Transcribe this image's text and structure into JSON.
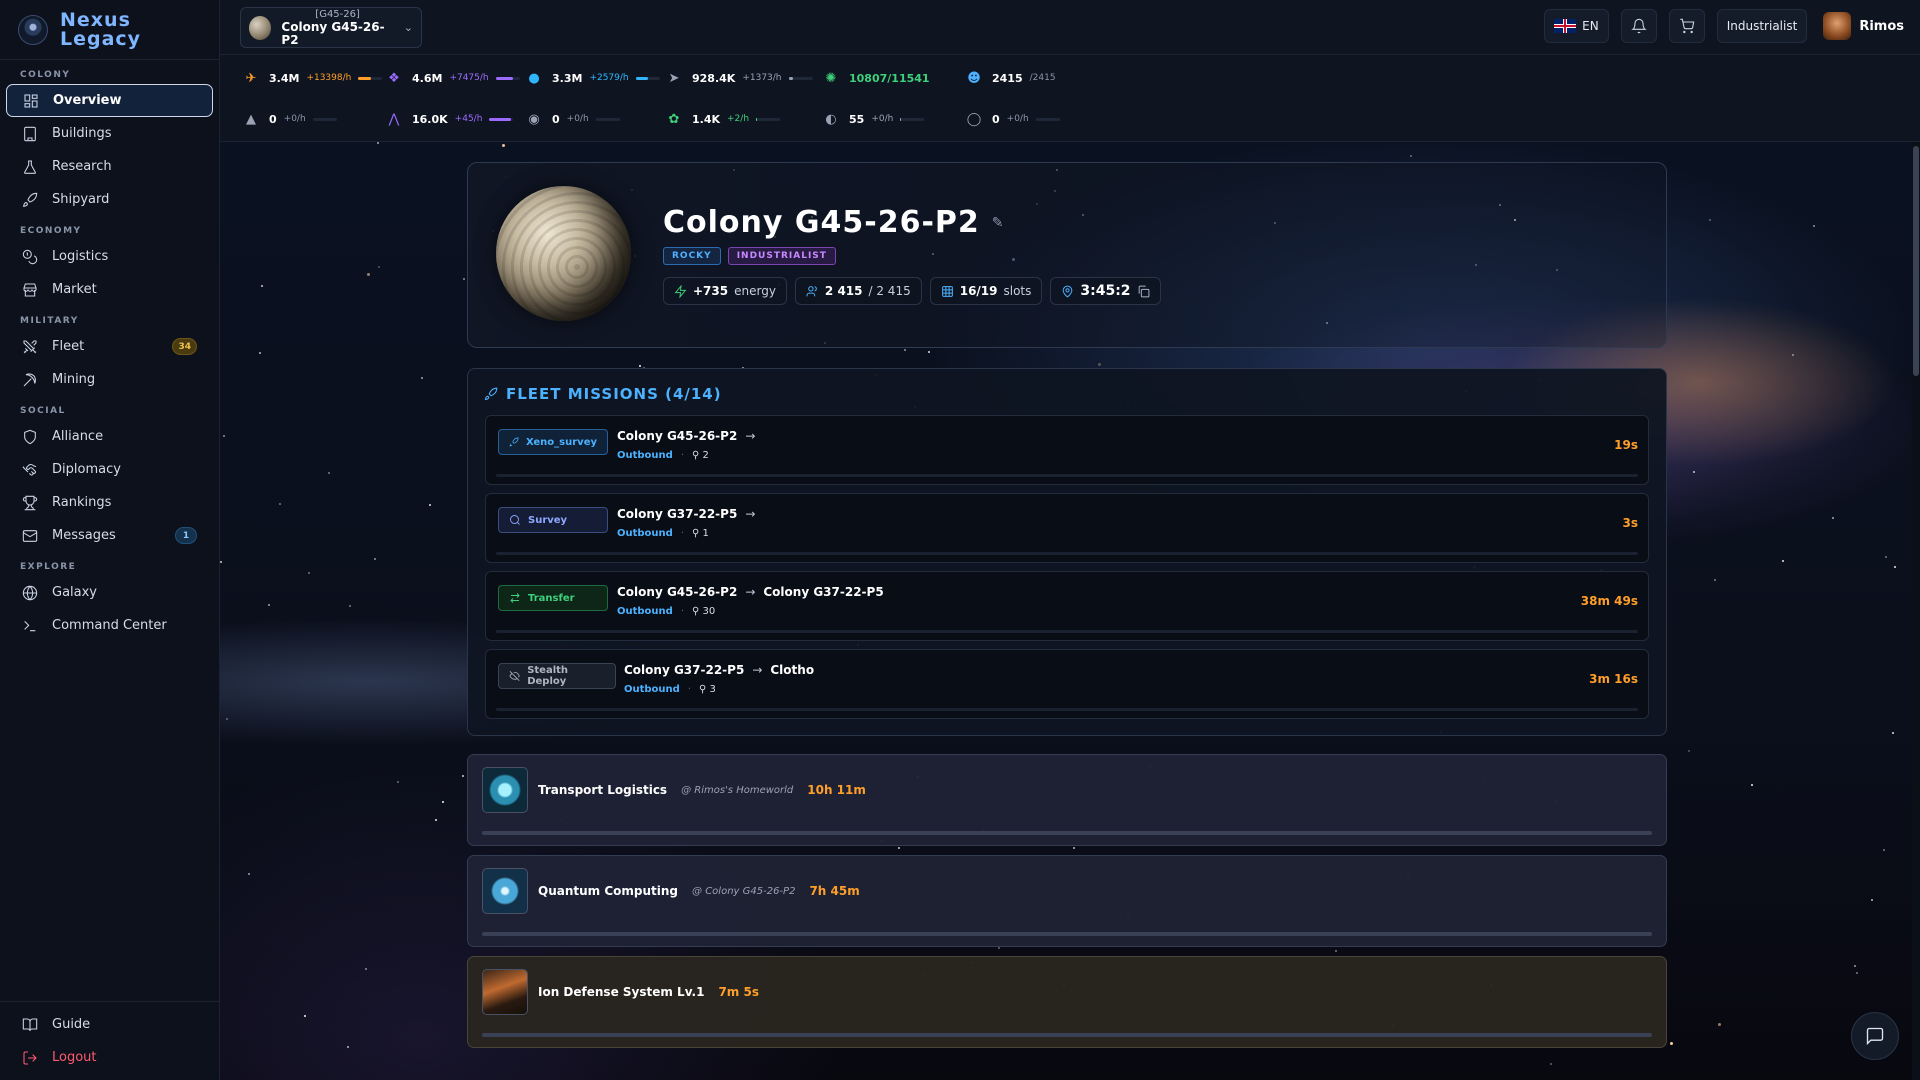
{
  "brand": {
    "line1": "Nexus",
    "line2": "Legacy"
  },
  "sidebar": {
    "sections": [
      {
        "title": "COLONY",
        "items": [
          {
            "label": "Overview",
            "icon": "dashboard-icon"
          },
          {
            "label": "Buildings",
            "icon": "building-icon"
          },
          {
            "label": "Research",
            "icon": "flask-icon"
          },
          {
            "label": "Shipyard",
            "icon": "rocket-icon"
          }
        ]
      },
      {
        "title": "ECONOMY",
        "items": [
          {
            "label": "Logistics",
            "icon": "coins-icon"
          },
          {
            "label": "Market",
            "icon": "store-icon"
          }
        ]
      },
      {
        "title": "MILITARY",
        "items": [
          {
            "label": "Fleet",
            "icon": "swords-icon",
            "badge": "34"
          },
          {
            "label": "Mining",
            "icon": "pickaxe-icon"
          }
        ]
      },
      {
        "title": "SOCIAL",
        "items": [
          {
            "label": "Alliance",
            "icon": "shield-icon"
          },
          {
            "label": "Diplomacy",
            "icon": "handshake-icon"
          },
          {
            "label": "Rankings",
            "icon": "trophy-icon"
          },
          {
            "label": "Messages",
            "icon": "mail-icon",
            "badge": "1"
          }
        ]
      },
      {
        "title": "EXPLORE",
        "items": [
          {
            "label": "Galaxy",
            "icon": "globe-icon"
          },
          {
            "label": "Command Center",
            "icon": "terminal-icon"
          }
        ]
      }
    ],
    "bottom": [
      {
        "label": "Guide",
        "icon": "book-icon"
      },
      {
        "label": "Logout",
        "icon": "logout-icon"
      }
    ]
  },
  "topbar": {
    "colony_coord": "[G45-26]",
    "colony_name": "Colony G45-26-P2",
    "language": "EN",
    "faction_label": "Industrialist",
    "username": "Rimos"
  },
  "resources": [
    {
      "value": "3.4M",
      "rate": "+13398/h",
      "color": "#ff9f2a",
      "fill": 0.55,
      "icon": "metal-icon"
    },
    {
      "value": "4.6M",
      "rate": "+7475/h",
      "color": "#9b6bff",
      "fill": 0.7,
      "icon": "crystal-icon"
    },
    {
      "value": "3.3M",
      "rate": "+2579/h",
      "color": "#2fb6ff",
      "fill": 0.5,
      "icon": "deuterium-icon"
    },
    {
      "value": "928.4K",
      "rate": "+1373/h",
      "color": "#9aa3b4",
      "fill": 0.15,
      "icon": "fuel-icon"
    },
    {
      "value": "10807/11541",
      "rate": "",
      "color": "#3ed07a",
      "fill": 0,
      "icon": "energy-icon"
    },
    {
      "value": "2415",
      "rate": "/2415",
      "color": "#4cb2ff",
      "fill": 0,
      "icon": "population-icon"
    },
    {
      "value": "0",
      "rate": "+0/h",
      "color": "#9aa3b4",
      "fill": 0,
      "icon": "ship-icon"
    },
    {
      "value": "16.0K",
      "rate": "+45/h",
      "color": "#9b6bff",
      "fill": 0.9,
      "icon": "jet-icon"
    },
    {
      "value": "0",
      "rate": "+0/h",
      "color": "#9aa3b4",
      "fill": 0,
      "icon": "ore-icon"
    },
    {
      "value": "1.4K",
      "rate": "+2/h",
      "color": "#3ed07a",
      "fill": 0.05,
      "icon": "bio-icon"
    },
    {
      "value": "55",
      "rate": "+0/h",
      "color": "#9aa3b4",
      "fill": 0.05,
      "icon": "dark-matter-icon"
    },
    {
      "value": "0",
      "rate": "+0/h",
      "color": "#9aa3b4",
      "fill": 0,
      "icon": "ring-icon"
    }
  ],
  "colony": {
    "title": "Colony G45-26-P2",
    "tags": [
      "ROCKY",
      "INDUSTRIALIST"
    ],
    "energy_value": "+735",
    "energy_label": "energy",
    "pop_value": "2 415",
    "pop_total": "/ 2 415",
    "slots_value": "16/19",
    "slots_label": "slots",
    "coords": "3:45:2"
  },
  "fleet": {
    "title": "FLEET MISSIONS (4/14)",
    "missions": [
      {
        "type": "Xeno_survey",
        "from": "Colony G45-26-P2",
        "to": "",
        "direction": "Outbound",
        "ships": "2",
        "time": "19s"
      },
      {
        "type": "Survey",
        "from": "Colony G37-22-P5",
        "to": "",
        "direction": "Outbound",
        "ships": "1",
        "time": "3s"
      },
      {
        "type": "Transfer",
        "from": "Colony G45-26-P2",
        "to": "Colony G37-22-P5",
        "direction": "Outbound",
        "ships": "30",
        "time": "38m 49s"
      },
      {
        "type": "Stealth Deploy",
        "from": "Colony G37-22-P5",
        "to": "Clotho",
        "direction": "Outbound",
        "ships": "3",
        "time": "3m 16s"
      }
    ]
  },
  "queue": [
    {
      "name": "Transport Logistics",
      "location": "@ Rimos's Homeworld",
      "time": "10h 11m"
    },
    {
      "name": "Quantum Computing",
      "location": "@ Colony G45-26-P2",
      "time": "7h 45m"
    },
    {
      "name": "Ion Defense System Lv.1",
      "location": "",
      "time": "7m 5s"
    }
  ]
}
